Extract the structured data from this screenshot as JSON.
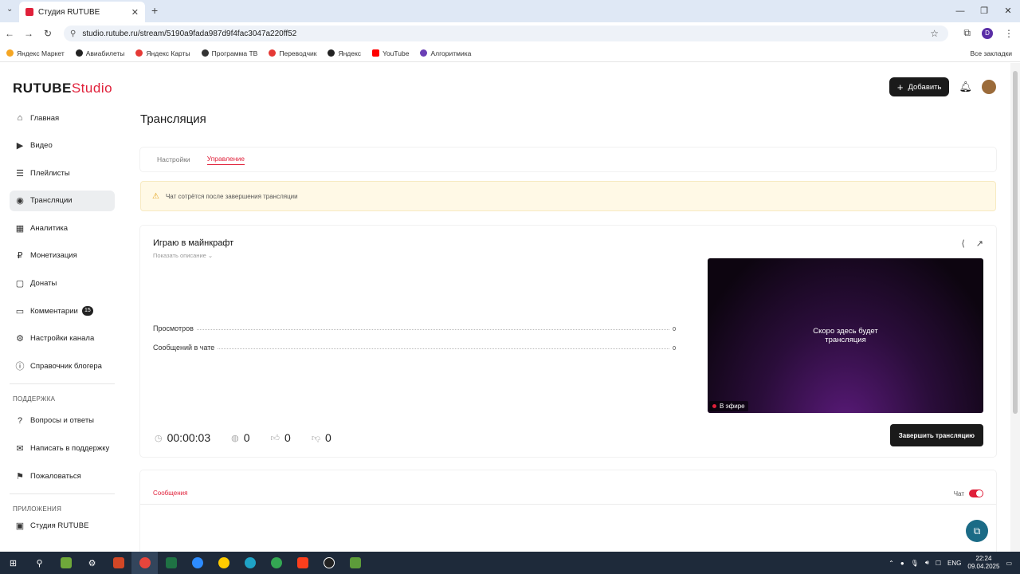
{
  "browser": {
    "tab_title": "Студия RUTUBE",
    "url": "studio.rutube.ru/stream/5190a9fada987d9f4fac3047a220ff52",
    "profile_letter": "D",
    "bookmarks": [
      {
        "label": "Яндекс Маркет",
        "color": "#f5a623"
      },
      {
        "label": "Авиабилеты",
        "color": "#222222"
      },
      {
        "label": "Яндекс Карты",
        "color": "#e53935"
      },
      {
        "label": "Программа ТВ",
        "color": "#333333"
      },
      {
        "label": "Переводчик",
        "color": "#e53935"
      },
      {
        "label": "Яндекс",
        "color": "#222222"
      },
      {
        "label": "YouTube",
        "color": "#ff0000"
      },
      {
        "label": "Алгоритмика",
        "color": "#6a3fb5"
      }
    ],
    "all_bookmarks": "Все закладки"
  },
  "logo": {
    "main": "RUTUBE",
    "suffix": "Studio"
  },
  "header": {
    "add_label": "Добавить"
  },
  "sidebar": {
    "items": [
      {
        "label": "Главная",
        "icon": "home-icon",
        "glyph": "⌂"
      },
      {
        "label": "Видео",
        "icon": "video-icon",
        "glyph": "▶"
      },
      {
        "label": "Плейлисты",
        "icon": "playlist-icon",
        "glyph": "☰"
      },
      {
        "label": "Трансляции",
        "icon": "broadcast-icon",
        "glyph": "◉"
      },
      {
        "label": "Аналитика",
        "icon": "analytics-icon",
        "glyph": "▦"
      },
      {
        "label": "Монетизация",
        "icon": "monetization-icon",
        "glyph": "₽"
      },
      {
        "label": "Донаты",
        "icon": "donate-icon",
        "glyph": "▢"
      },
      {
        "label": "Комментарии",
        "icon": "comments-icon",
        "glyph": "▭",
        "badge": "15"
      },
      {
        "label": "Настройки канала",
        "icon": "settings-icon",
        "glyph": "⚙"
      },
      {
        "label": "Справочник блогера",
        "icon": "help-icon",
        "glyph": "ⓘ"
      }
    ],
    "support_title": "ПОДДЕРЖКА",
    "support_items": [
      {
        "label": "Вопросы и ответы",
        "icon": "question-icon",
        "glyph": "?"
      },
      {
        "label": "Написать в поддержку",
        "icon": "mail-icon",
        "glyph": "✉"
      },
      {
        "label": "Пожаловаться",
        "icon": "flag-icon",
        "glyph": "⚑"
      }
    ],
    "apps_title": "ПРИЛОЖЕНИЯ",
    "apps_items": [
      {
        "label": "Студия RUTUBE"
      }
    ]
  },
  "page": {
    "title": "Трансляция",
    "tabs": [
      "Настройки",
      "Управление"
    ],
    "warning": "Чат сотрётся после завершения трансляции",
    "stream": {
      "title": "Играю в майнкрафт",
      "show_description": "Показать описание",
      "stats": [
        {
          "label": "Просмотров",
          "value": "0"
        },
        {
          "label": "Сообщений в чате",
          "value": "0"
        }
      ],
      "player_message_line1": "Скоро здесь будет",
      "player_message_line2": "трансляция",
      "live_label": "В эфире",
      "duration": "00:00:03",
      "viewers": "0",
      "likes": "0",
      "dislikes": "0",
      "end_button": "Завершить трансляцию"
    },
    "chat": {
      "tab": "Сообщения",
      "toggle_label": "Чат",
      "enabled": true
    }
  },
  "taskbar": {
    "lang": "ENG",
    "time": "22:24",
    "date": "09.04.2025"
  }
}
